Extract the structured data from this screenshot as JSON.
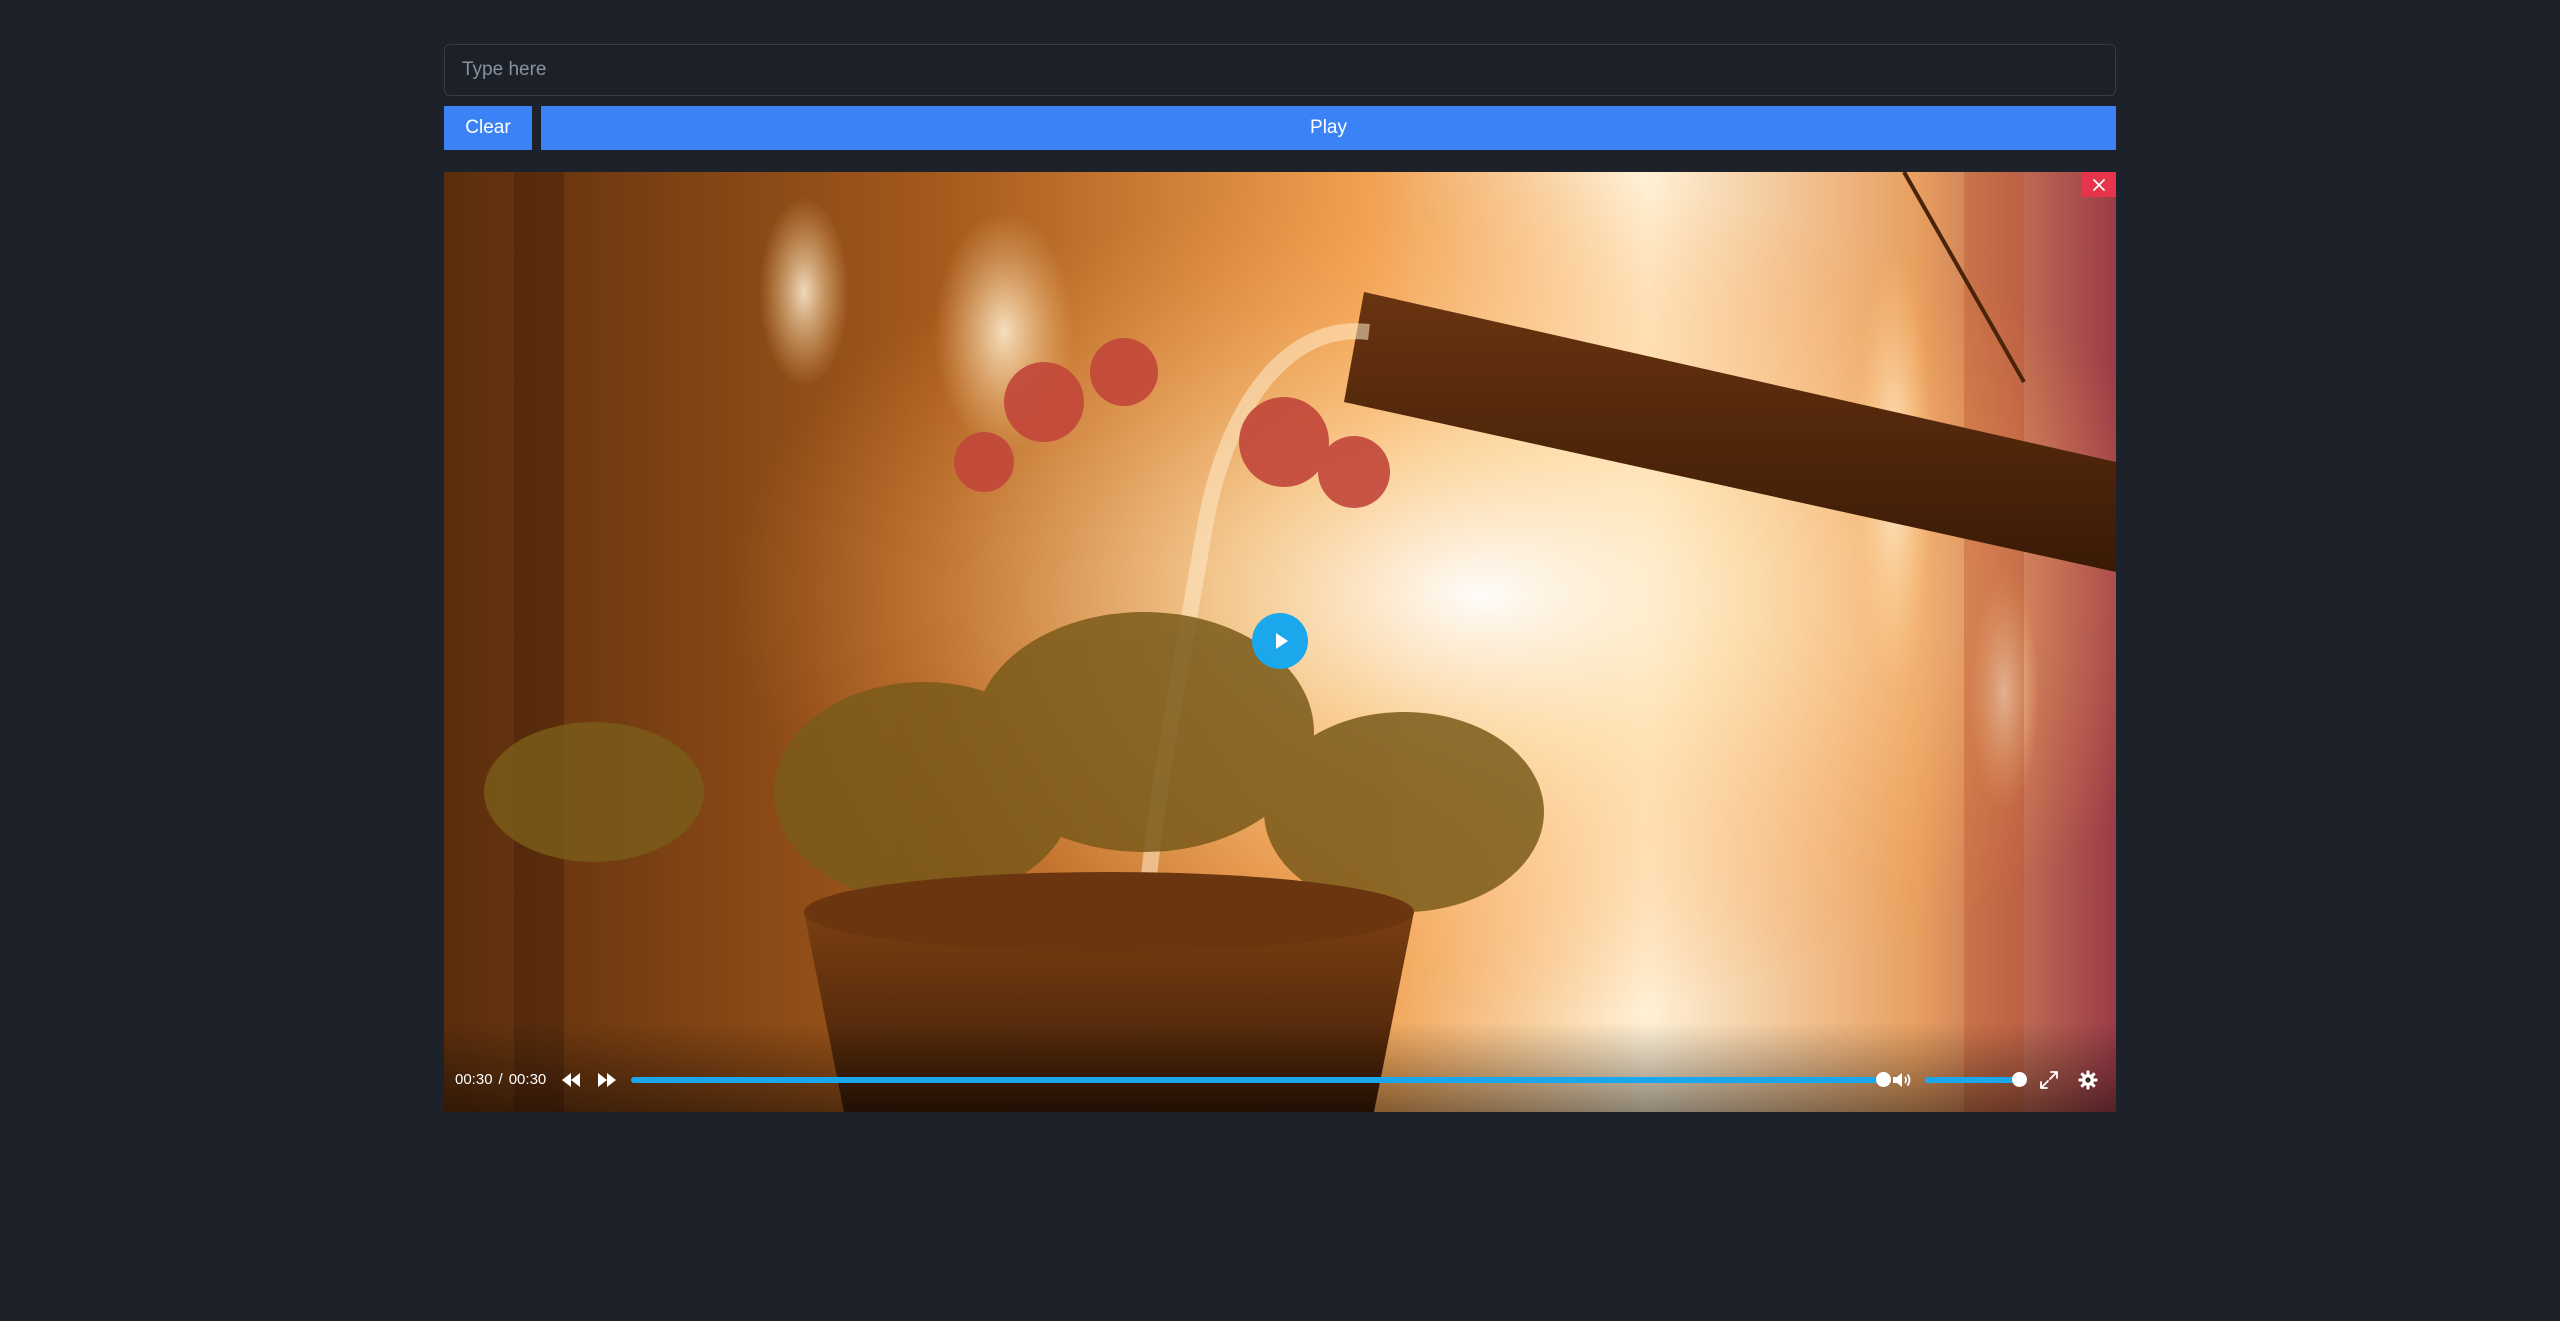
{
  "search": {
    "placeholder": "Type here",
    "value": ""
  },
  "buttons": {
    "clear_label": "Clear",
    "play_label": "Play"
  },
  "player": {
    "current_time": "00:30",
    "separator": "/",
    "duration": "00:30",
    "progress_fraction": 1.0,
    "volume_fraction": 1.0,
    "icons": {
      "close": "close-icon",
      "big_play": "play-icon",
      "rewind": "rewind-icon",
      "forward": "fast-forward-icon",
      "volume": "volume-icon",
      "fullscreen": "fullscreen-icon",
      "settings": "gear-icon"
    }
  },
  "colors": {
    "accent_blue": "#3b82f6",
    "player_accent": "#1aa7ec",
    "close_red": "#e6344a",
    "page_bg": "#1d222a"
  }
}
